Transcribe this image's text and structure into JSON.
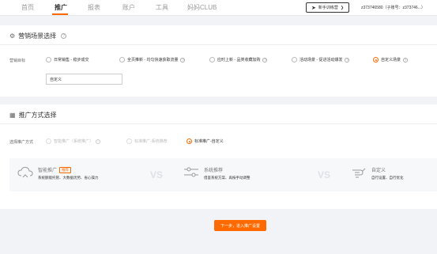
{
  "nav": {
    "items": [
      "首页",
      "推广",
      "报表",
      "账户",
      "工具",
      "妈妈CLUB"
    ],
    "active_index": 1
  },
  "guide_button": {
    "label": "新手训练营"
  },
  "account": {
    "text": "z373746580（子账号：z373746...）"
  },
  "marketing": {
    "title": "营销场景选择",
    "row_label": "营销目标",
    "options": [
      {
        "label": "日常销售 - 稳步成交",
        "checked": false
      },
      {
        "label": "全页推新 - 均匀快速获取流量",
        "checked": false
      },
      {
        "label": "应时上新 - 品类收藏加购",
        "checked": false
      },
      {
        "label": "活动场景 - 促进活动爆发",
        "checked": false
      },
      {
        "label": "自定义场景",
        "checked": true
      }
    ],
    "custom_input_value": "自定义"
  },
  "promotion": {
    "title": "推广方式选择",
    "row_label": "选择推广方式",
    "options": [
      {
        "label": "智能推广（系统推广）",
        "checked": false,
        "disabled": true
      },
      {
        "label": "标准推广-系统推荐",
        "checked": false,
        "disabled": true
      },
      {
        "label": "标准推广-自定义",
        "checked": true,
        "disabled": false
      }
    ],
    "compare": [
      {
        "title": "智能推广",
        "badge": "推荐",
        "desc": "系统额能托管、大数据优势、省心操力",
        "icon": "cloud-icon"
      },
      {
        "title": "系统推荐",
        "badge": "",
        "desc": "借鉴系统方案、再按手动调整",
        "icon": "sliders-icon"
      },
      {
        "title": "自定义",
        "badge": "",
        "desc": "自行设置、自行优化",
        "icon": "hand-icon"
      }
    ],
    "vs_label": "VS"
  },
  "next_button": {
    "label": "下一步，进入推广设置"
  },
  "colors": {
    "accent": "#ff6a00",
    "background": "#f2f3f7"
  }
}
